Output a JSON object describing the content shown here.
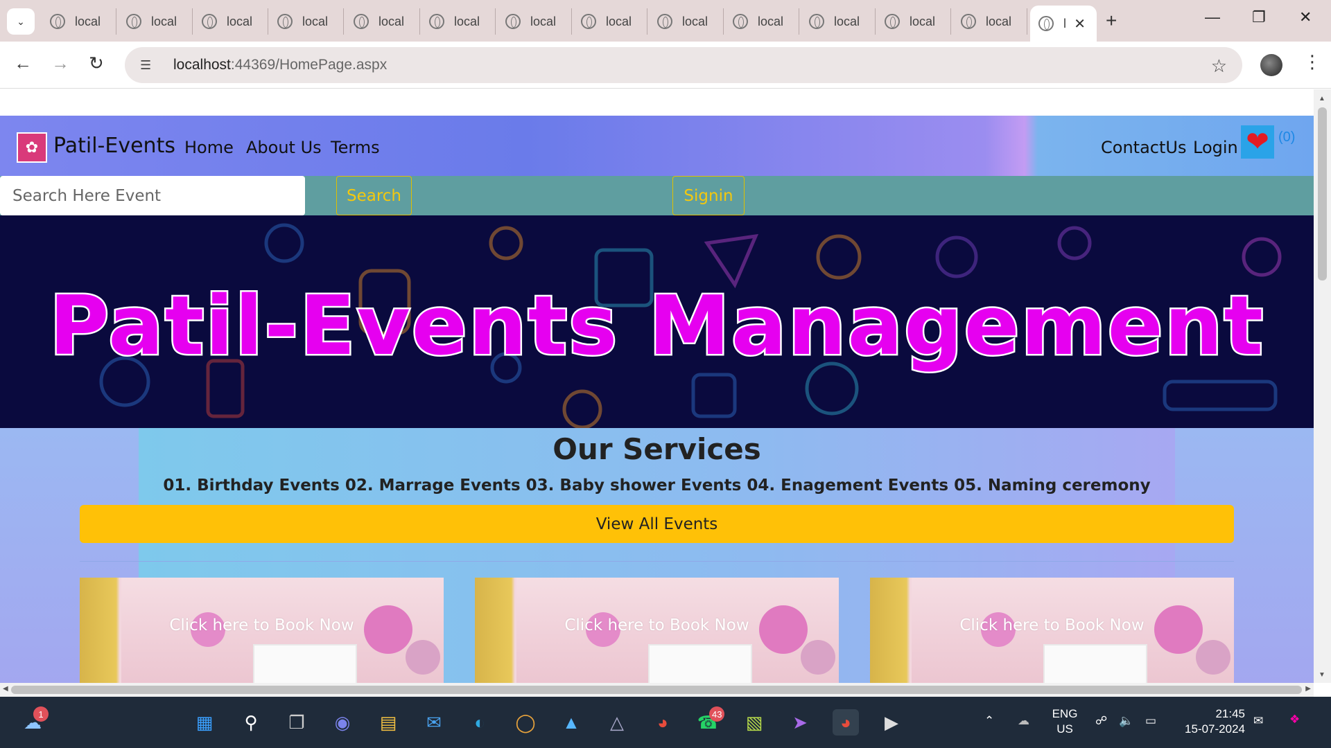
{
  "browser": {
    "tabs": [
      {
        "label": "local"
      },
      {
        "label": "local"
      },
      {
        "label": "local"
      },
      {
        "label": "local"
      },
      {
        "label": "local"
      },
      {
        "label": "local"
      },
      {
        "label": "local"
      },
      {
        "label": "local"
      },
      {
        "label": "local"
      },
      {
        "label": "local"
      },
      {
        "label": "local"
      },
      {
        "label": "local"
      },
      {
        "label": "local"
      },
      {
        "label": "l"
      }
    ],
    "url_host": "localhost",
    "url_path": ":44369/HomePage.aspx"
  },
  "site": {
    "brand": "Patil-Events",
    "nav": {
      "home": "Home",
      "about": "About Us",
      "terms": "Terms",
      "contact": "ContactUs",
      "login": "Login",
      "cart_count": "(0)"
    },
    "search": {
      "placeholder": "Search Here Event",
      "search_label": "Search",
      "signin_label": "Signin"
    },
    "banner_title": "Patil-Events Management",
    "services": {
      "title": "Our Services",
      "list": "01. Birthday Events 02. Marrage Events 03. Baby shower Events 04. Enagement Events 05. Naming ceremony",
      "view_all": "View All Events"
    },
    "cards": [
      {
        "label": "Click here to Book Now"
      },
      {
        "label": "Click here to Book Now"
      },
      {
        "label": "Click here to Book Now"
      }
    ]
  },
  "taskbar": {
    "weather_badge": "1",
    "whatsapp_badge": "43",
    "lang_line1": "ENG",
    "lang_line2": "US",
    "time": "21:45",
    "date": "15-07-2024"
  },
  "colors": {
    "nav_gradient": "#7d86ef",
    "search_bar": "#5f9ea0",
    "accent_yellow": "#ffc107",
    "banner_text": "#e600f0"
  }
}
